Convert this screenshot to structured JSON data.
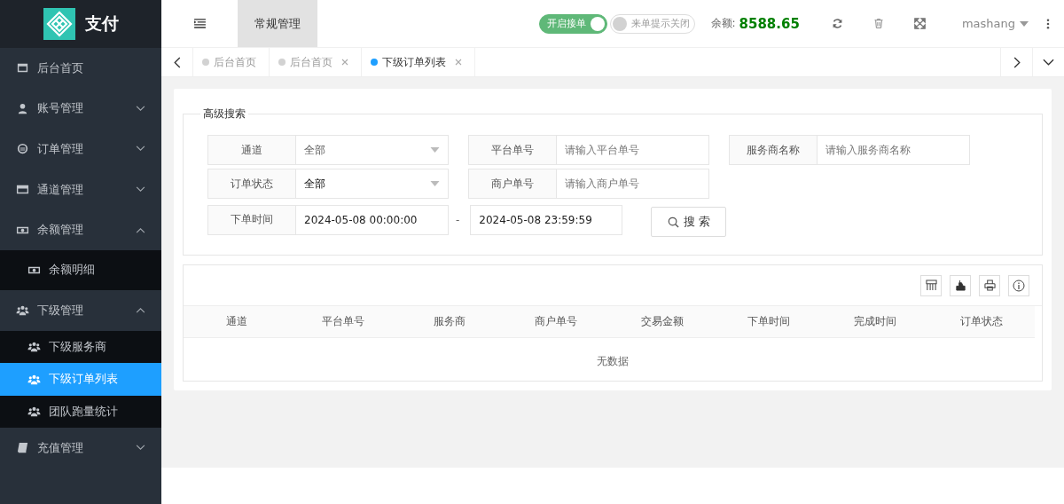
{
  "logo": {
    "title": "支付"
  },
  "sidebar": {
    "items": [
      {
        "label": "后台首页",
        "kind": "window",
        "selected": false
      },
      {
        "label": "账号管理",
        "kind": "user",
        "selected": false,
        "expanded": false
      },
      {
        "label": "订单管理",
        "kind": "order",
        "selected": false,
        "expanded": false
      },
      {
        "label": "通道管理",
        "kind": "card",
        "selected": false,
        "expanded": false
      },
      {
        "label": "余额管理",
        "kind": "money",
        "selected": false,
        "expanded": true,
        "children": [
          {
            "label": "余额明细",
            "kind": "money",
            "selected": false
          }
        ]
      },
      {
        "label": "下级管理",
        "kind": "group",
        "selected": false,
        "expanded": true,
        "children": [
          {
            "label": "下级服务商",
            "kind": "group",
            "selected": false
          },
          {
            "label": "下级订单列表",
            "kind": "group",
            "selected": true
          },
          {
            "label": "团队跑量统计",
            "kind": "group",
            "selected": false
          }
        ]
      },
      {
        "label": "充值管理",
        "kind": "book",
        "selected": false,
        "expanded": false
      }
    ]
  },
  "header": {
    "nav_tabs": [
      {
        "label": "常规管理",
        "selected": true
      }
    ],
    "switches": [
      {
        "label": "开启接单",
        "on": true
      },
      {
        "label": "来单提示关闭",
        "on": false
      }
    ],
    "balance_label": "余额:",
    "balance": "8588.65",
    "user": "mashang"
  },
  "tabs": [
    {
      "label": "后台首页",
      "selected": false,
      "closable": false
    },
    {
      "label": "后台首页",
      "selected": false,
      "closable": true
    },
    {
      "label": "下级订单列表",
      "selected": true,
      "closable": true
    }
  ],
  "search": {
    "legend": "高级搜索",
    "rows": [
      [
        {
          "label": "通道",
          "kind": "select",
          "value": "全部",
          "strong": false
        },
        {
          "label": "平台单号",
          "kind": "input",
          "placeholder": "请输入平台单号"
        },
        {
          "label": "服务商名称",
          "kind": "input",
          "placeholder": "请输入服务商名称"
        }
      ],
      [
        {
          "label": "订单状态",
          "kind": "select",
          "value": "全部",
          "strong": true
        },
        {
          "label": "商户单号",
          "kind": "input",
          "placeholder": "请输入商户单号"
        }
      ]
    ],
    "time": {
      "label": "下单时间",
      "start": "2024-05-08 00:00:00",
      "separator": "-",
      "end": "2024-05-08 23:59:59"
    },
    "button": "搜 索"
  },
  "table": {
    "columns": [
      "通道",
      "平台单号",
      "服务商",
      "商户单号",
      "交易金额",
      "下单时间",
      "完成时间",
      "订单状态"
    ],
    "empty_text": "无数据"
  }
}
